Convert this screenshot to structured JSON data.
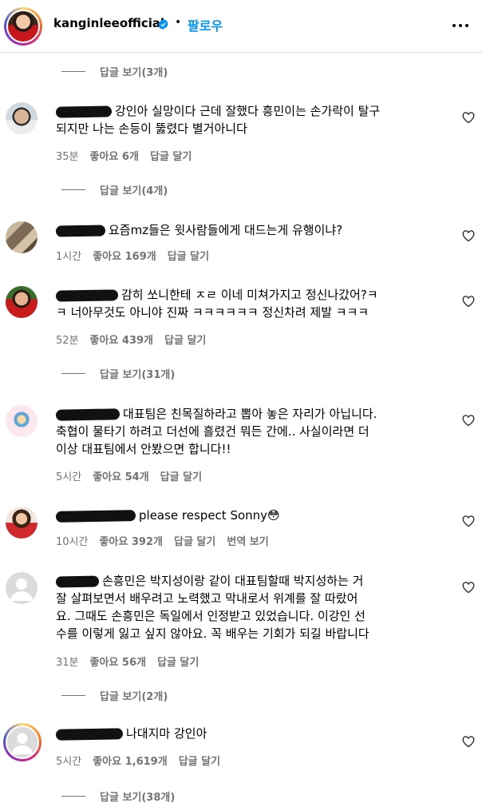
{
  "header": {
    "username": "kanginleeofficial",
    "separator": "•",
    "follow_label": "팔로우"
  },
  "colors": {
    "accent": "#0095f6",
    "muted": "#737373",
    "verified": "#0095f6"
  },
  "icons": {
    "verified": "verified-badge-icon",
    "more": "more-options-icon",
    "like": "heart-icon",
    "avatar_placeholder": "default-avatar-icon"
  },
  "replies": [
    {
      "label": "답글 보기(3개)"
    },
    {
      "label": "답글 보기(4개)"
    },
    {
      "label": "답글 보기(31개)"
    },
    {
      "label": "답글 보기(2개)"
    },
    {
      "label": "답글 보기(38개)"
    }
  ],
  "comments": [
    {
      "text_lines": [
        "강인아 실망이다 근데 잘했다 흥민이는 손가락이 탈구",
        "되지만 나는 손등이 뚫렸다 별거아니다"
      ],
      "time": "35분",
      "likes": "좋아요 6개",
      "reply": "답글 달기"
    },
    {
      "text_lines": [
        "요즘mz들은 윗사람들에게 대드는게 유행이냐?"
      ],
      "time": "1시간",
      "likes": "좋아요 169개",
      "reply": "답글 달기"
    },
    {
      "text_lines": [
        "감히 쏘니한테 ㅈㄹ 이네 미쳐가지고 정신나갔어?ㅋ",
        "ㅋ 너아무것도 아니야 진짜 ㅋㅋㅋㅋㅋㅋ 정신차려 제발 ㅋㅋㅋ"
      ],
      "time": "52분",
      "likes": "좋아요 439개",
      "reply": "답글 달기"
    },
    {
      "text_lines": [
        "대표팀은 친목질하라고 뽑아 놓은 자리가 아닙니다.",
        "축협이 물타기 하려고 더선에 흘렸건 뭐든 간에.. 사실이라면 더",
        "이상 대표팀에서 안봤으면 합니다!!"
      ],
      "time": "5시간",
      "likes": "좋아요 54개",
      "reply": "답글 달기"
    },
    {
      "text_lines": [
        "please respect Sonny😳"
      ],
      "time": "10시간",
      "likes": "좋아요 392개",
      "reply": "답글 달기",
      "translate": "번역 보기"
    },
    {
      "text_lines": [
        "손흥민은 박지성이랑 같이 대표팀할때 박지성하는 거",
        "잘 살펴보면서 배우려고 노력했고 막내로서 위계를 잘 따랐어",
        "요. 그때도 손흥민은 독일에서 인정받고 있었습니다. 이강인 선",
        "수를 이렇게 잃고 싶지 않아요. 꼭 배우는 기회가 되길 바랍니다"
      ],
      "time": "31분",
      "likes": "좋아요 56개",
      "reply": "답글 달기"
    },
    {
      "text_lines": [
        "나대지마 강인아"
      ],
      "time": "5시간",
      "likes": "좋아요 1,619개",
      "reply": "답글 달기"
    }
  ]
}
